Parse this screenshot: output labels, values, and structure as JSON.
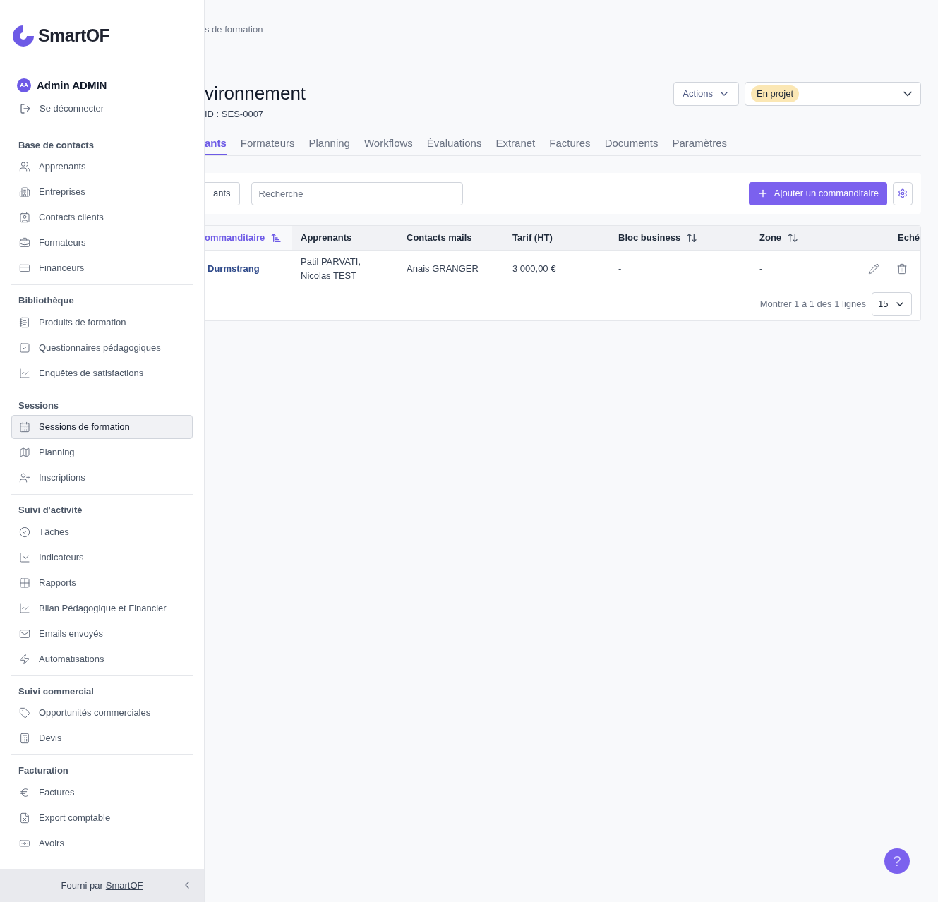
{
  "sidebar": {
    "logo": "SmartOF",
    "user": {
      "initials": "AA",
      "name": "Admin ADMIN"
    },
    "logout": "Se déconnecter",
    "groups": [
      {
        "title": "Base de contacts",
        "items": [
          {
            "label": "Apprenants",
            "selected": false
          },
          {
            "label": "Entreprises",
            "selected": false
          },
          {
            "label": "Contacts clients",
            "selected": false
          },
          {
            "label": "Formateurs",
            "selected": false
          },
          {
            "label": "Financeurs",
            "selected": false
          }
        ]
      },
      {
        "title": "Bibliothèque",
        "items": [
          {
            "label": "Produits de formation",
            "selected": false
          },
          {
            "label": "Questionnaires pédagogiques",
            "selected": false
          },
          {
            "label": "Enquêtes de satisfactions",
            "selected": false
          }
        ]
      },
      {
        "title": "Sessions",
        "items": [
          {
            "label": "Sessions de formation",
            "selected": true
          },
          {
            "label": "Planning",
            "selected": false
          },
          {
            "label": "Inscriptions",
            "selected": false
          }
        ]
      },
      {
        "title": "Suivi d'activité",
        "items": [
          {
            "label": "Tâches",
            "selected": false
          },
          {
            "label": "Indicateurs",
            "selected": false
          },
          {
            "label": "Rapports",
            "selected": false
          },
          {
            "label": "Bilan Pédagogique et Financier",
            "selected": false
          },
          {
            "label": "Emails envoyés",
            "selected": false
          },
          {
            "label": "Automatisations",
            "selected": false
          }
        ]
      },
      {
        "title": "Suivi commercial",
        "items": [
          {
            "label": "Opportunités commerciales",
            "selected": false
          },
          {
            "label": "Devis",
            "selected": false
          }
        ]
      },
      {
        "title": "Facturation",
        "items": [
          {
            "label": "Factures",
            "selected": false
          },
          {
            "label": "Export comptable",
            "selected": false
          },
          {
            "label": "Avoirs",
            "selected": false
          }
        ]
      }
    ],
    "footer": {
      "prefix": "Fourni par",
      "link": "SmartOF"
    }
  },
  "main": {
    "breadcrumb": "s de formation",
    "title": "vironnement",
    "id": "ID : SES-0007",
    "actions": "Actions",
    "status": "En projet",
    "tabs": [
      {
        "label": "ants",
        "selected": true
      },
      {
        "label": "Formateurs",
        "selected": false
      },
      {
        "label": "Planning",
        "selected": false
      },
      {
        "label": "Workflows",
        "selected": false
      },
      {
        "label": "Évaluations",
        "selected": false
      },
      {
        "label": "Extranet",
        "selected": false
      },
      {
        "label": "Factures",
        "selected": false
      },
      {
        "label": "Documents",
        "selected": false
      },
      {
        "label": "Paramètres",
        "selected": false
      }
    ],
    "toolbar": {
      "filter_button": "ants",
      "search": {
        "placeholder": "Recherche"
      },
      "add_button": "Ajouter un commanditaire"
    },
    "table": {
      "columns": [
        {
          "label": "ommanditaire",
          "sorted": true
        },
        {
          "label": "Apprenants"
        },
        {
          "label": "Contacts mails"
        },
        {
          "label": "Tarif (HT)"
        },
        {
          "label": "Bloc business",
          "sorted": false
        },
        {
          "label": "Zone",
          "sorted": false
        },
        {
          "label": "Eché"
        }
      ],
      "rows": [
        {
          "cells": [
            "Durmstrang",
            "Patil PARVATI, Nicolas TEST",
            "Anais GRANGER",
            "3 000,00 €",
            "-",
            "-"
          ]
        }
      ]
    },
    "pagination": {
      "summary": "Montrer 1 à 1 des 1 lignes",
      "page_size": "15"
    },
    "help": "?"
  }
}
